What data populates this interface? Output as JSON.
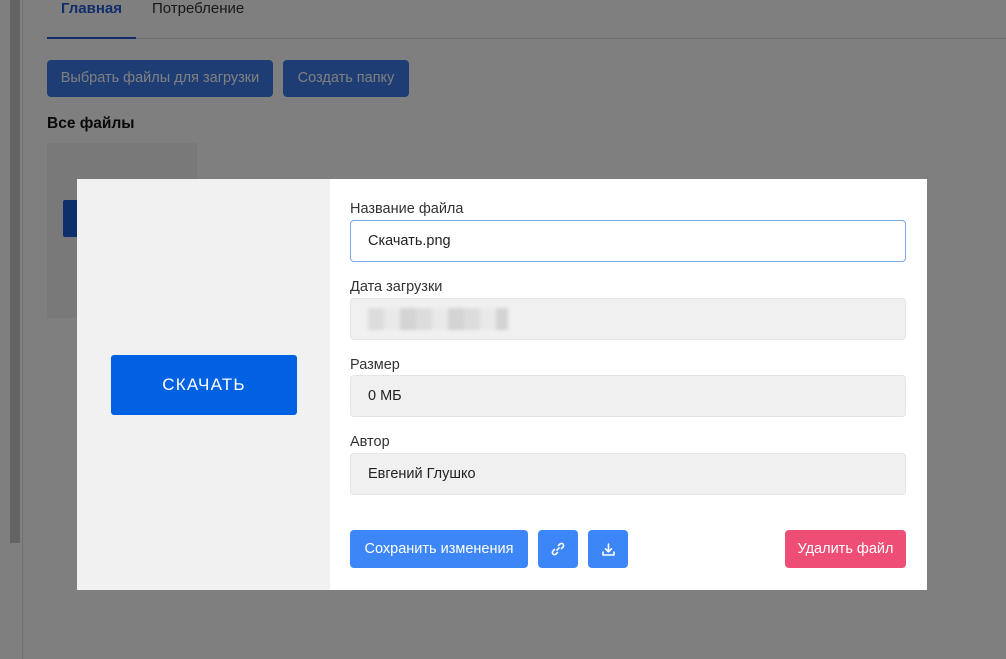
{
  "tabs": [
    {
      "label": "Главная",
      "active": true
    },
    {
      "label": "Потребление",
      "active": false
    }
  ],
  "toolbar": {
    "upload_label": "Выбрать файлы для загрузки",
    "create_folder_label": "Создать папку"
  },
  "files_section": {
    "title": "Все файлы"
  },
  "modal": {
    "preview_button_label": "СКАЧАТЬ",
    "fields": {
      "filename": {
        "label": "Название файла",
        "value": "Скачать.png"
      },
      "upload_date": {
        "label": "Дата загрузки"
      },
      "size": {
        "label": "Размер",
        "value": "0 МБ"
      },
      "author": {
        "label": "Автор",
        "value": "Евгений Глушко"
      }
    },
    "actions": {
      "save_label": "Сохранить изменения",
      "link_icon": "link-icon",
      "download_icon": "download-icon",
      "delete_label": "Удалить файл"
    }
  },
  "colors": {
    "primary": "#3d86f7",
    "preview_button": "#0062e3",
    "danger": "#ee4e75",
    "active_tab": "#1f5ad6"
  }
}
